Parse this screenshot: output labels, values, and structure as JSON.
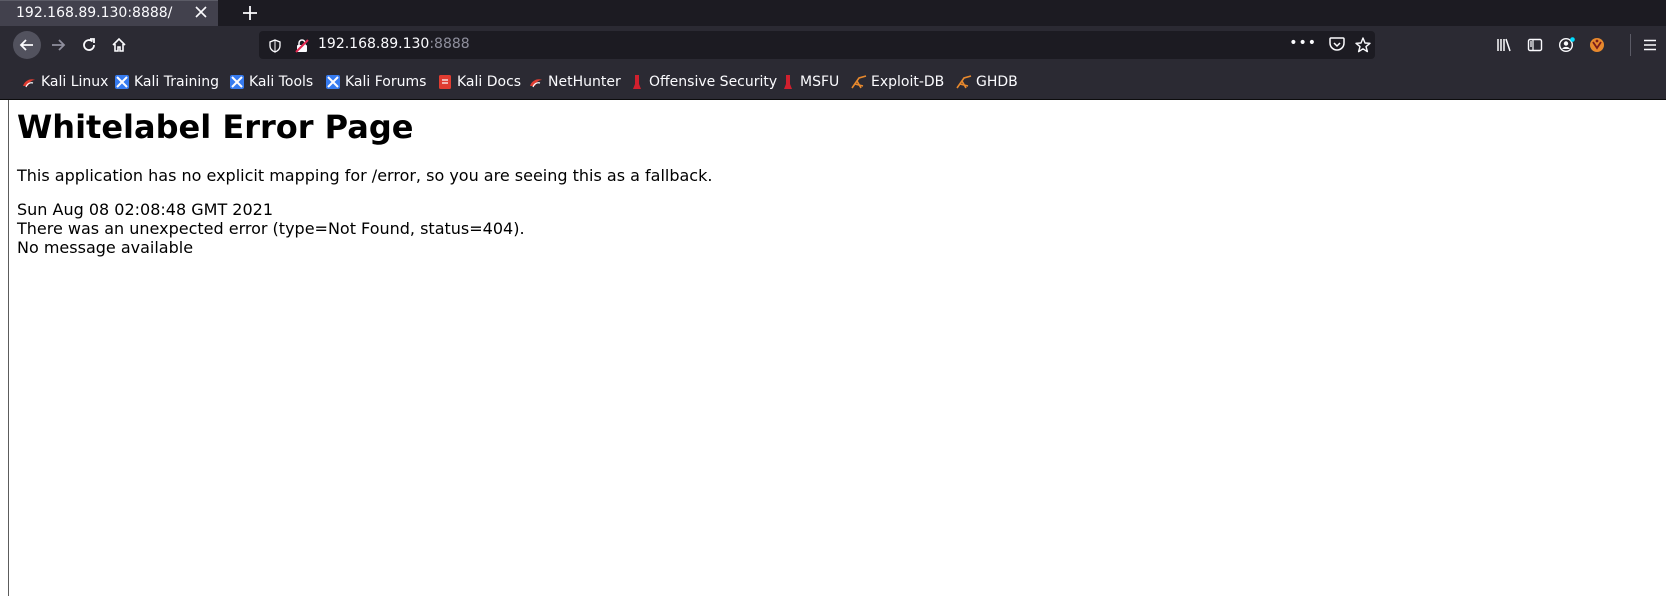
{
  "window": {
    "tab_title": "192.168.89.130:8888/",
    "tab_close_icon": "close-icon",
    "new_tab_icon": "plus-icon"
  },
  "navbar": {
    "url_host": "192.168.89.130",
    "url_port": ":8888",
    "page_actions_label": "•••"
  },
  "bookmarks": [
    {
      "label": "Kali Linux",
      "icon": "kali-dragon-icon",
      "color": "#e03c31"
    },
    {
      "label": "Kali Training",
      "icon": "kali-training-icon",
      "color": "#367bf0"
    },
    {
      "label": "Kali Tools",
      "icon": "kali-tools-icon",
      "color": "#367bf0"
    },
    {
      "label": "Kali Forums",
      "icon": "kali-forums-icon",
      "color": "#367bf0"
    },
    {
      "label": "Kali Docs",
      "icon": "kali-docs-icon",
      "color": "#e03c31"
    },
    {
      "label": "NetHunter",
      "icon": "nethunter-icon",
      "color": "#e03c31"
    },
    {
      "label": "Offensive Security",
      "icon": "offsec-icon",
      "color": "#d0202e"
    },
    {
      "label": "MSFU",
      "icon": "msfu-icon",
      "color": "#d0202e"
    },
    {
      "label": "Exploit-DB",
      "icon": "exploit-db-icon",
      "color": "#e8892d"
    },
    {
      "label": "GHDB",
      "icon": "ghdb-icon",
      "color": "#e8892d"
    }
  ],
  "page": {
    "heading": "Whitelabel Error Page",
    "message": "This application has no explicit mapping for /error, so you are seeing this as a fallback.",
    "timestamp": "Sun Aug 08 02:08:48 GMT 2021",
    "error_line": "There was an unexpected error (type=Not Found, status=404).",
    "detail": "No message available"
  },
  "colors": {
    "tabstrip_bg": "#1c1b22",
    "toolbar_bg": "#2b2a33",
    "urlbar_bg": "#1c1b22",
    "text_light": "#fbfbfe"
  }
}
